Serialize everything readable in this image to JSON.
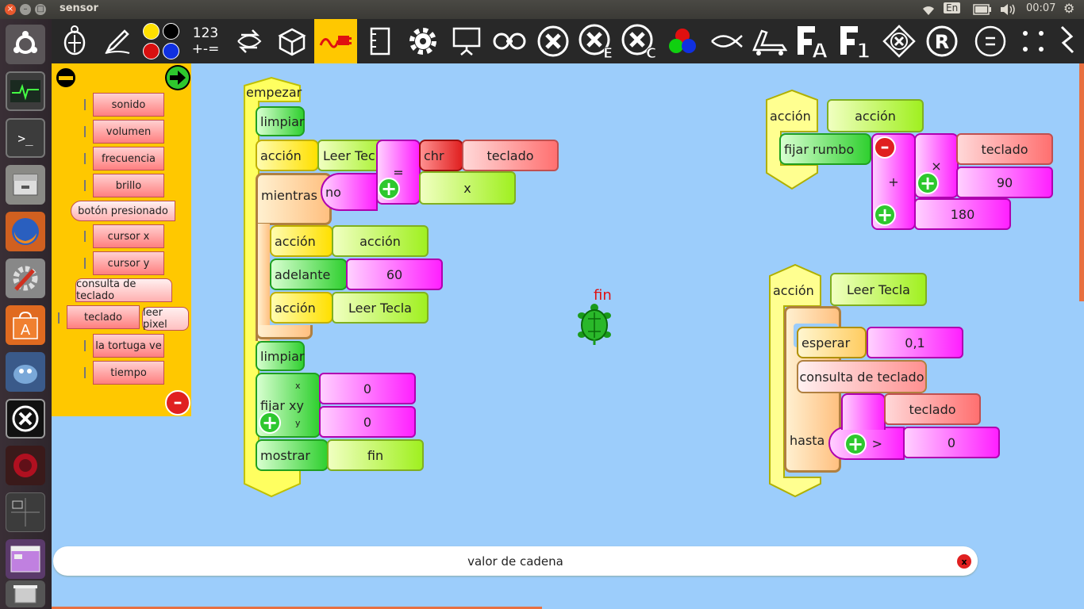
{
  "window": {
    "title": "sensor",
    "close": "×",
    "minimize": "–",
    "maximize": "□"
  },
  "tray": {
    "wifi": "wifi-icon",
    "lang": "En",
    "battery": "battery-icon",
    "volume": "volume-icon",
    "time": "00:07",
    "settings": "⚙"
  },
  "launcher": {
    "items": [
      "ubuntu-dash",
      "system-monitor",
      "terminal",
      "file-manager",
      "firefox",
      "system-settings",
      "software-center",
      "pidgin",
      "turtle-blocks",
      "ruby",
      "workspace-switcher",
      "app-window",
      "trash"
    ]
  },
  "toolbar": {
    "numbers_label": "123",
    "ops_label": "+-="
  },
  "palette": {
    "items": [
      "sonido",
      "volumen",
      "frecuencia",
      "brillo",
      "botón presionado",
      "cursor x",
      "cursor y",
      "consulta de teclado",
      "teclado",
      "leer pixel",
      "la tortuga ve",
      "tiempo"
    ]
  },
  "canvas": {
    "stack1": {
      "start": "empezar",
      "clear1": "limpiar",
      "action1": "acción",
      "action1_arg": "Leer Tecla",
      "eq": "=",
      "chr": "chr",
      "chr_arg": "teclado",
      "while": "mientras",
      "not": "no",
      "x_arg": "x",
      "action2": "acción",
      "action2_arg": "acción",
      "forward": "adelante",
      "forward_arg": "60",
      "action3": "acción",
      "action3_arg": "Leer Tecla",
      "clear2": "limpiar",
      "setxy": "fijar xy",
      "x_label": "x",
      "y_label": "y",
      "setxy_x": "0",
      "setxy_y": "0",
      "show": "mostrar",
      "show_arg": "fin"
    },
    "stack2": {
      "action": "acción",
      "action_name": "acción",
      "setheading": "fijar rumbo",
      "plus": "+",
      "times": "×",
      "teclado": "teclado",
      "val90": "90",
      "val180": "180"
    },
    "stack3": {
      "action": "acción",
      "action_name": "Leer Tecla",
      "wait": "esperar",
      "wait_arg": "0,1",
      "kbcheck": "consulta de teclado",
      "until": "hasta",
      "gt": ">",
      "teclado": "teclado",
      "val0": "0"
    },
    "turtle_label": "fin"
  },
  "status": {
    "text": "valor de cadena",
    "close": "x"
  },
  "colors": {
    "palette_bg": "#ffc800",
    "canvas_bg": "#9ccdfb",
    "toolbar_bg": "#282828",
    "active_tool": "#ffc800"
  }
}
